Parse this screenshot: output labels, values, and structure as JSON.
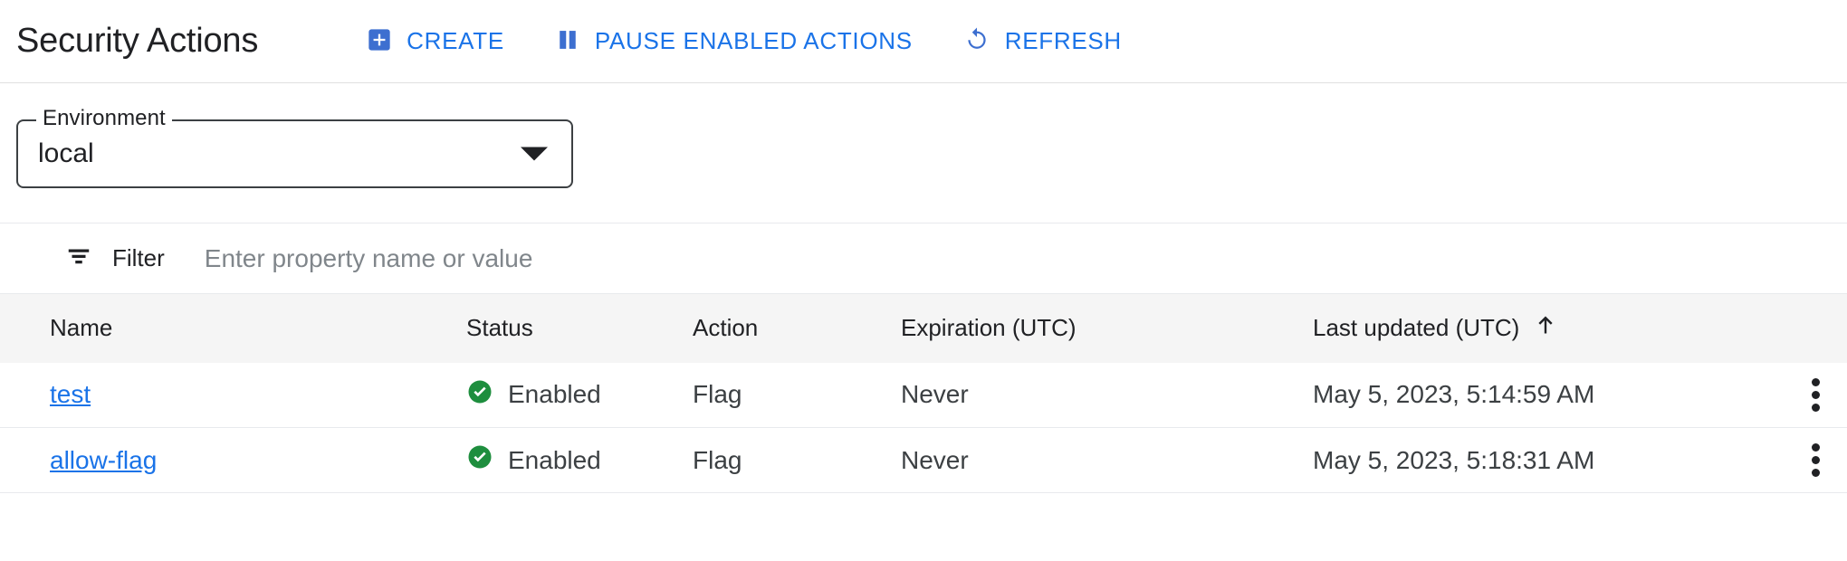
{
  "header": {
    "title": "Security Actions",
    "actions": [
      {
        "label": "CREATE",
        "icon": "add-box-icon"
      },
      {
        "label": "PAUSE ENABLED ACTIONS",
        "icon": "pause-icon"
      },
      {
        "label": "REFRESH",
        "icon": "refresh-icon"
      }
    ]
  },
  "environment": {
    "label": "Environment",
    "value": "local",
    "options": [
      "local"
    ]
  },
  "filter": {
    "label": "Filter",
    "placeholder": "Enter property name or value",
    "value": "",
    "icon": "filter-list-icon"
  },
  "table": {
    "columns": [
      {
        "key": "name",
        "label": "Name"
      },
      {
        "key": "status",
        "label": "Status"
      },
      {
        "key": "action",
        "label": "Action"
      },
      {
        "key": "expiration",
        "label": "Expiration (UTC)"
      },
      {
        "key": "last_updated",
        "label": "Last updated (UTC)"
      }
    ],
    "sort": {
      "column": "last_updated",
      "direction": "ascending",
      "icon": "arrow-upward-icon"
    },
    "rows": [
      {
        "name": "test",
        "status": "Enabled",
        "status_icon": "check-circle-icon",
        "action": "Flag",
        "expiration": "Never",
        "last_updated": "May 5, 2023, 5:14:59 AM",
        "menu_icon": "more-vert-icon"
      },
      {
        "name": "allow-flag",
        "status": "Enabled",
        "status_icon": "check-circle-icon",
        "action": "Flag",
        "expiration": "Never",
        "last_updated": "May 5, 2023, 5:18:31 AM",
        "menu_icon": "more-vert-icon"
      }
    ]
  },
  "colors": {
    "accent_blue": "#1a73e8",
    "status_green": "#1e8e3e",
    "text_primary": "#202124",
    "text_secondary": "#3c4043",
    "placeholder": "#80868b",
    "header_bg": "#f5f5f5",
    "divider": "#e8eaed"
  }
}
